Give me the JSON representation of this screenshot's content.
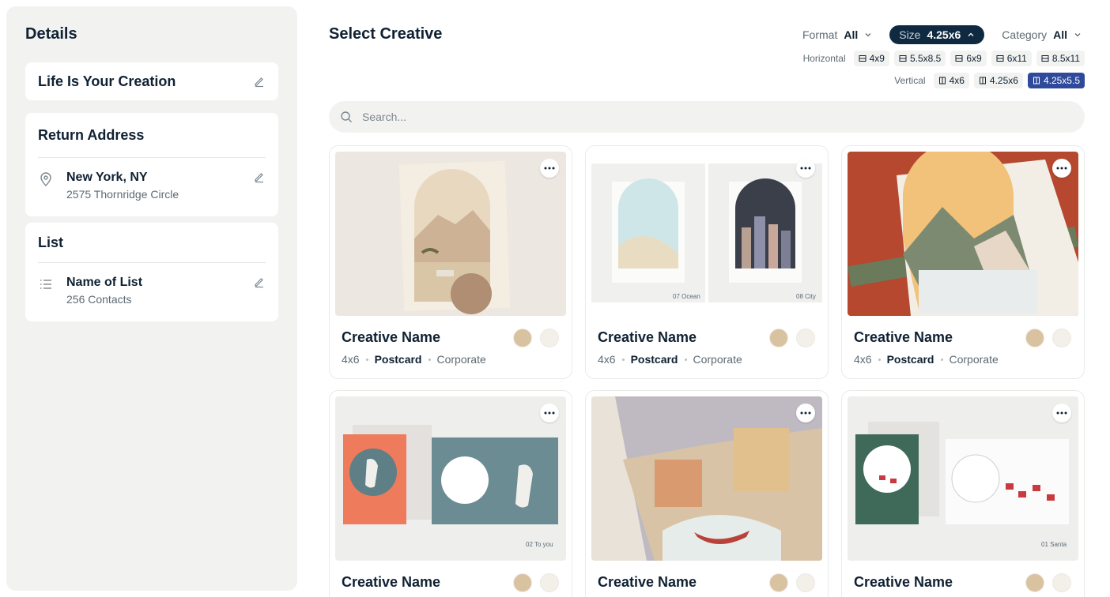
{
  "sidebar": {
    "title": "Details",
    "message_card": {
      "title": "Life Is Your Creation"
    },
    "return_address": {
      "title": "Return Address",
      "city": "New York, NY",
      "street": "2575 Thornridge Circle"
    },
    "list": {
      "title": "List",
      "name": "Name of List",
      "contacts": "256 Contacts"
    }
  },
  "main": {
    "title": "Select Creative",
    "filters": {
      "format": {
        "label": "Format",
        "value": "All"
      },
      "size": {
        "label": "Size",
        "value": "4.25x6"
      },
      "category": {
        "label": "Category",
        "value": "All"
      }
    },
    "horizontal": {
      "label": "Horizontal",
      "sizes": [
        "4x9",
        "5.5x8.5",
        "6x9",
        "6x11",
        "8.5x11"
      ]
    },
    "vertical": {
      "label": "Vertical",
      "sizes": [
        "4x6",
        "4.25x6",
        "4.25x5.5"
      ],
      "selected": "4.25x5.5"
    },
    "search": {
      "placeholder": "Search..."
    },
    "creatives": [
      {
        "name": "Creative Name",
        "size": "4x6",
        "format": "Postcard",
        "category": "Corporate",
        "caption_left": "",
        "caption_right": ""
      },
      {
        "name": "Creative Name",
        "size": "4x6",
        "format": "Postcard",
        "category": "Corporate",
        "caption_left": "07 Ocean",
        "caption_right": "08 City"
      },
      {
        "name": "Creative Name",
        "size": "4x6",
        "format": "Postcard",
        "category": "Corporate",
        "caption_left": "",
        "caption_right": ""
      },
      {
        "name": "Creative Name",
        "size": "",
        "format": "",
        "category": "",
        "caption_left": "",
        "caption_right": "02 To you"
      },
      {
        "name": "Creative Name",
        "size": "",
        "format": "",
        "category": "",
        "caption_left": "",
        "caption_right": ""
      },
      {
        "name": "Creative Name",
        "size": "",
        "format": "",
        "category": "",
        "caption_left": "",
        "caption_right": "01 Santa"
      }
    ]
  },
  "colors": {
    "navy": "#0f2a40",
    "selected_chip": "#2f4a9a",
    "sidebar_bg": "#f2f3f1"
  }
}
